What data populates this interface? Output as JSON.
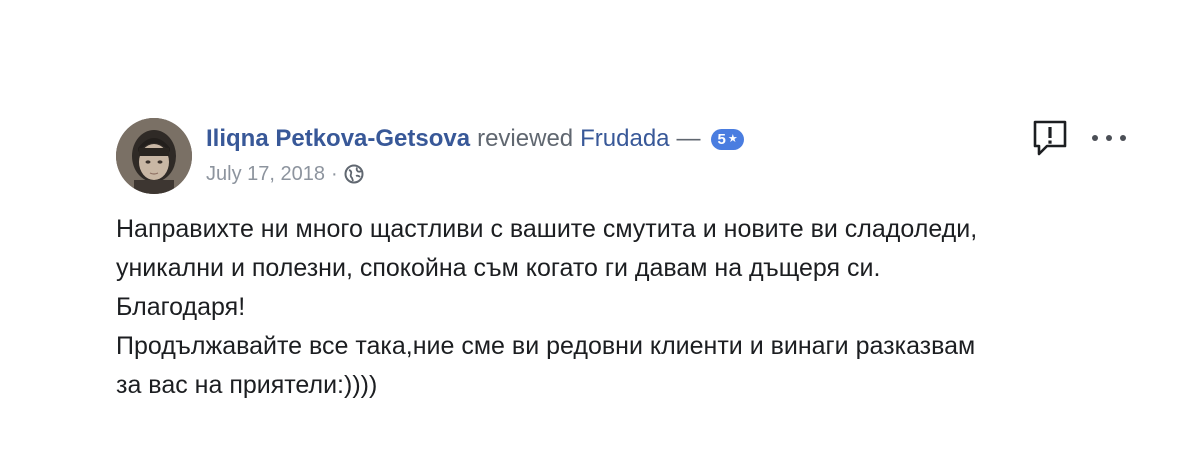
{
  "review": {
    "author": "Iliqna Petkova-Getsova",
    "verb": "reviewed",
    "page": "Frudada",
    "dash": "—",
    "rating": "5",
    "date": "July 17, 2018",
    "separator": "·",
    "privacy_icon": "globe-icon",
    "text_lines": [
      "Направихте ни много щастливи с вашите смутита и новите ви сладоледи,",
      "уникални и полезни, спокойна съм когато ги давам на дъщеря си.",
      "Благодаря!",
      "Продължавайте все така,ние сме ви редовни клиенти и винаги разказвам",
      "за вас на приятели:))))"
    ]
  },
  "actions": {
    "report_icon": "report-icon",
    "more_icon": "more-options-icon"
  },
  "colors": {
    "link": "#385898",
    "secondary_text": "#606770",
    "meta_text": "#8d949e",
    "badge": "#4a7de0",
    "body_text": "#1c1e21"
  }
}
